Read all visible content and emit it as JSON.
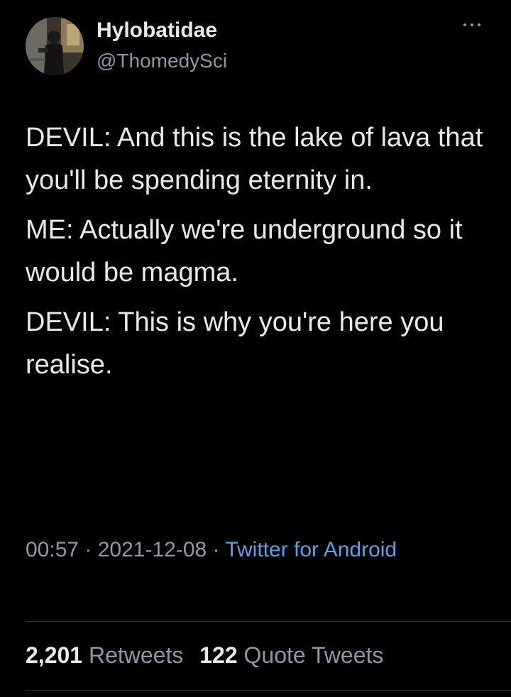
{
  "author": {
    "display_name": "Hylobatidae",
    "handle": "@ThomedySci",
    "avatar_icon": "profile-photo"
  },
  "more_icon": "more-options-icon",
  "tweet": {
    "paragraphs": [
      "DEVIL: And this is the lake of lava that you'll be spending eternity in.",
      "ME: Actually we're underground so it would be magma.",
      "DEVIL: This is why you're here you realise."
    ]
  },
  "meta": {
    "time": "00:57",
    "separator": " · ",
    "date": "2021-12-08",
    "source": "Twitter for Android"
  },
  "stats": {
    "retweets_count": "2,201",
    "retweets_label": "Retweets",
    "quotes_count": "122",
    "quotes_label": "Quote Tweets"
  },
  "colors": {
    "background": "#000000",
    "text": "#e7e9ea",
    "secondary": "#8b98a5",
    "link": "#5aa0e3",
    "divider": "#2f3336"
  }
}
